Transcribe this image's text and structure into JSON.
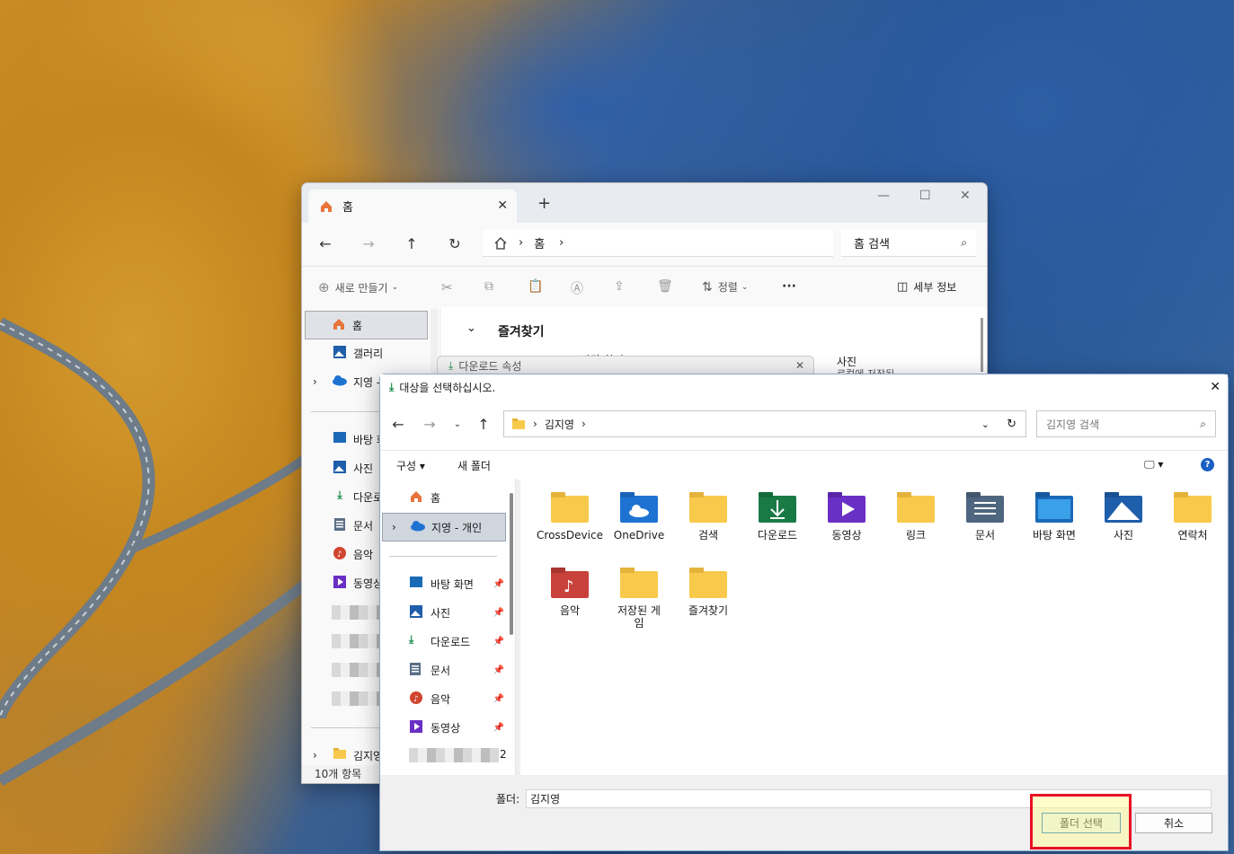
{
  "explorer": {
    "tab_label": "홈",
    "address_home": "홈",
    "search_placeholder": "홈 검색",
    "toolbar": {
      "new": "새로 만들기",
      "sort": "정렬",
      "more": "···",
      "details": "세부 정보"
    },
    "nav": [
      {
        "label": "홈"
      },
      {
        "label": "갤러리"
      },
      {
        "label": "지영 -"
      },
      {
        "label": "바탕 화"
      },
      {
        "label": "사진"
      },
      {
        "label": "다운로"
      },
      {
        "label": "문서"
      },
      {
        "label": "음악"
      },
      {
        "label": "동영상"
      },
      {
        "label": "김지영"
      }
    ],
    "favorites_header": "즐겨찾기",
    "peek_item1": "바탕 화면",
    "peek_item2_title": "사진",
    "peek_item2_sub": "로컬에 저장된",
    "status": "10개 항목"
  },
  "download_props": {
    "title": "다운로드 속성"
  },
  "dialog": {
    "title": "대상을 선택하십시오.",
    "address_path": "김지영",
    "search_placeholder": "김지영 검색",
    "toolbar_organize": "구성 ▾",
    "toolbar_new_folder": "새 폴더",
    "left": [
      {
        "label": "홈",
        "pinned": false
      },
      {
        "label": "지영 - 개인",
        "pinned": false
      },
      {
        "label": "바탕 화면",
        "pinned": true
      },
      {
        "label": "사진",
        "pinned": true
      },
      {
        "label": "다운로드",
        "pinned": true
      },
      {
        "label": "문서",
        "pinned": true
      },
      {
        "label": "음악",
        "pinned": true
      },
      {
        "label": "동영상",
        "pinned": true
      }
    ],
    "left_blur_suffix": "2",
    "folders": [
      {
        "label": "CrossDevice",
        "icon": "folder-icon"
      },
      {
        "label": "OneDrive",
        "icon": "onedrive-folder-icon"
      },
      {
        "label": "검색",
        "icon": "folder-icon"
      },
      {
        "label": "다운로드",
        "icon": "downloads-folder-icon"
      },
      {
        "label": "동영상",
        "icon": "videos-folder-icon"
      },
      {
        "label": "링크",
        "icon": "folder-icon"
      },
      {
        "label": "문서",
        "icon": "documents-folder-icon"
      },
      {
        "label": "바탕 화면",
        "icon": "desktop-folder-icon"
      },
      {
        "label": "사진",
        "icon": "pictures-folder-icon"
      },
      {
        "label": "연락처",
        "icon": "folder-icon"
      },
      {
        "label": "음악",
        "icon": "music-folder-icon"
      },
      {
        "label": "저장된 게임",
        "icon": "folder-icon"
      },
      {
        "label": "즐겨찾기",
        "icon": "folder-icon"
      }
    ],
    "folder_label": "폴더:",
    "folder_value": "김지영",
    "select_button": "폴더 선택",
    "cancel_button": "취소"
  },
  "colors": {
    "folder_yellow": "#f8c94a",
    "accent_blue": "#0067c0",
    "highlight_red": "#e81123"
  }
}
